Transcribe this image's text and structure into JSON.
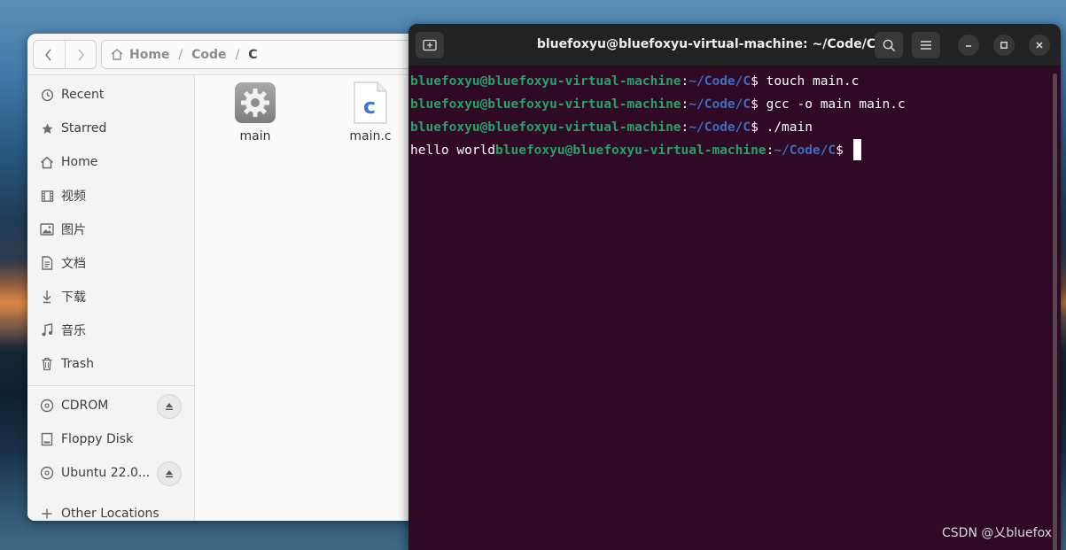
{
  "files": {
    "nav": {
      "back_icon": "chevron-left-icon",
      "forward_icon": "chevron-right-icon"
    },
    "path": [
      "Home",
      "Code",
      "C"
    ],
    "path_separator": "/",
    "sidebar": {
      "items": [
        {
          "label": "Recent",
          "icon": "clock-icon"
        },
        {
          "label": "Starred",
          "icon": "star-icon"
        },
        {
          "label": "Home",
          "icon": "home-icon"
        },
        {
          "label": "视频",
          "icon": "video-icon"
        },
        {
          "label": "图片",
          "icon": "image-icon"
        },
        {
          "label": "文档",
          "icon": "document-icon"
        },
        {
          "label": "下载",
          "icon": "download-icon"
        },
        {
          "label": "音乐",
          "icon": "music-icon"
        },
        {
          "label": "Trash",
          "icon": "trash-icon"
        }
      ],
      "devices": [
        {
          "label": "CDROM",
          "icon": "disc-icon",
          "eject": true
        },
        {
          "label": "Floppy Disk",
          "icon": "drive-icon",
          "eject": false
        },
        {
          "label": "Ubuntu 22.0...",
          "icon": "disc-icon",
          "eject": true
        }
      ],
      "other": {
        "label": "Other Locations",
        "icon": "plus-icon"
      }
    },
    "items": [
      {
        "name": "main",
        "icon": "executable-gear-icon"
      },
      {
        "name": "main.c",
        "icon": "c-source-file-icon",
        "glyph": "c"
      }
    ]
  },
  "terminal": {
    "title": "bluefoxyu@bluefoxyu-virtual-machine: ~/Code/C",
    "prompt_user": "bluefoxyu@bluefoxyu-virtual-machine",
    "prompt_path": "~/Code/C",
    "prompt_colon": ":",
    "prompt_symbol": "$",
    "lines": [
      {
        "output": "",
        "command": " touch main.c"
      },
      {
        "output": "",
        "command": " gcc -o main main.c"
      },
      {
        "output": "",
        "command": " ./main"
      },
      {
        "output": "hello world",
        "command": " "
      }
    ],
    "colors": {
      "background": "#300a24",
      "user": "#26a269",
      "path": "#3b6fc4"
    }
  },
  "watermark": "CSDN @乂bluefox"
}
